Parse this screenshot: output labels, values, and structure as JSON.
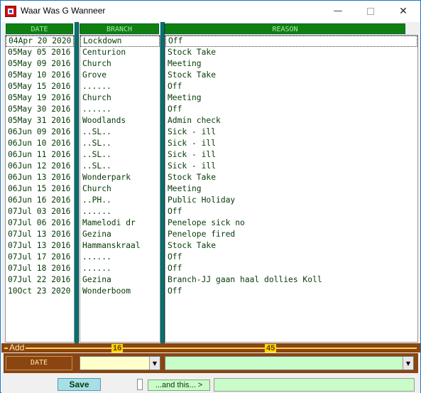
{
  "window": {
    "title": "Waar Was G Wanneer",
    "minimize_symbol": "—",
    "close_symbol": "✕"
  },
  "columns": {
    "date_header": "DATE",
    "branch_header": "BRANCH",
    "reason_header": "REASON"
  },
  "rows": [
    {
      "date": "04Apr 20 2020",
      "branch": "Lockdown",
      "reason": "Off"
    },
    {
      "date": "05May 05 2016",
      "branch": "Centurion",
      "reason": "Stock Take"
    },
    {
      "date": "05May 09 2016",
      "branch": "Church",
      "reason": "Meeting"
    },
    {
      "date": "05May 10 2016",
      "branch": "Grove",
      "reason": "Stock Take"
    },
    {
      "date": "05May 15 2016",
      "branch": "......",
      "reason": "Off"
    },
    {
      "date": "05May 19 2016",
      "branch": "Church",
      "reason": "Meeting"
    },
    {
      "date": "05May 30 2016",
      "branch": "......",
      "reason": "Off"
    },
    {
      "date": "05May 31 2016",
      "branch": "Woodlands",
      "reason": "Admin check"
    },
    {
      "date": "06Jun 09 2016",
      "branch": "..SL..",
      "reason": "Sick - ill"
    },
    {
      "date": "06Jun 10 2016",
      "branch": "..SL..",
      "reason": "Sick - ill"
    },
    {
      "date": "06Jun 11 2016",
      "branch": "..SL..",
      "reason": "Sick - ill"
    },
    {
      "date": "06Jun 12 2016",
      "branch": "..SL..",
      "reason": "Sick - ill"
    },
    {
      "date": "06Jun 13 2016",
      "branch": "Wonderpark",
      "reason": "Stock Take"
    },
    {
      "date": "06Jun 15 2016",
      "branch": "Church",
      "reason": "Meeting"
    },
    {
      "date": "06Jun 16 2016",
      "branch": "..PH..",
      "reason": "Public Holiday"
    },
    {
      "date": "07Jul 03 2016",
      "branch": "......",
      "reason": "Off"
    },
    {
      "date": "07Jul 06 2016",
      "branch": "Mamelodi dr",
      "reason": "Penelope sick no"
    },
    {
      "date": "07Jul 13 2016",
      "branch": "Gezina",
      "reason": "Penelope fired"
    },
    {
      "date": "07Jul 13 2016",
      "branch": "Hammanskraal",
      "reason": "Stock Take"
    },
    {
      "date": "07Jul 17 2016",
      "branch": "......",
      "reason": "Off"
    },
    {
      "date": "07Jul 18 2016",
      "branch": "......",
      "reason": "Off"
    },
    {
      "date": "07Jul 22 2016",
      "branch": "Gezina",
      "reason": "Branch-JJ gaan haal dollies Koll"
    },
    {
      "date": "10Oct 23 2020",
      "branch": "Wonderboom",
      "reason": "Off"
    }
  ],
  "add_panel": {
    "label": "Add",
    "branch_count": "16",
    "reason_count": "45",
    "date_button": "DATE",
    "branch_value": "",
    "reason_value": "",
    "dropdown_symbol": "▼"
  },
  "footer": {
    "save_label": "Save",
    "and_this_label": "...and this... >",
    "and_this_value": ""
  },
  "colors": {
    "header_green": "#0f800f",
    "text_green": "#063a06",
    "splitter_teal": "#0a7070",
    "panel_brown": "#8a4510",
    "count_yellow": "#ffd800",
    "field_green": "#c8fcc8",
    "field_yellow": "#ffffcc"
  }
}
